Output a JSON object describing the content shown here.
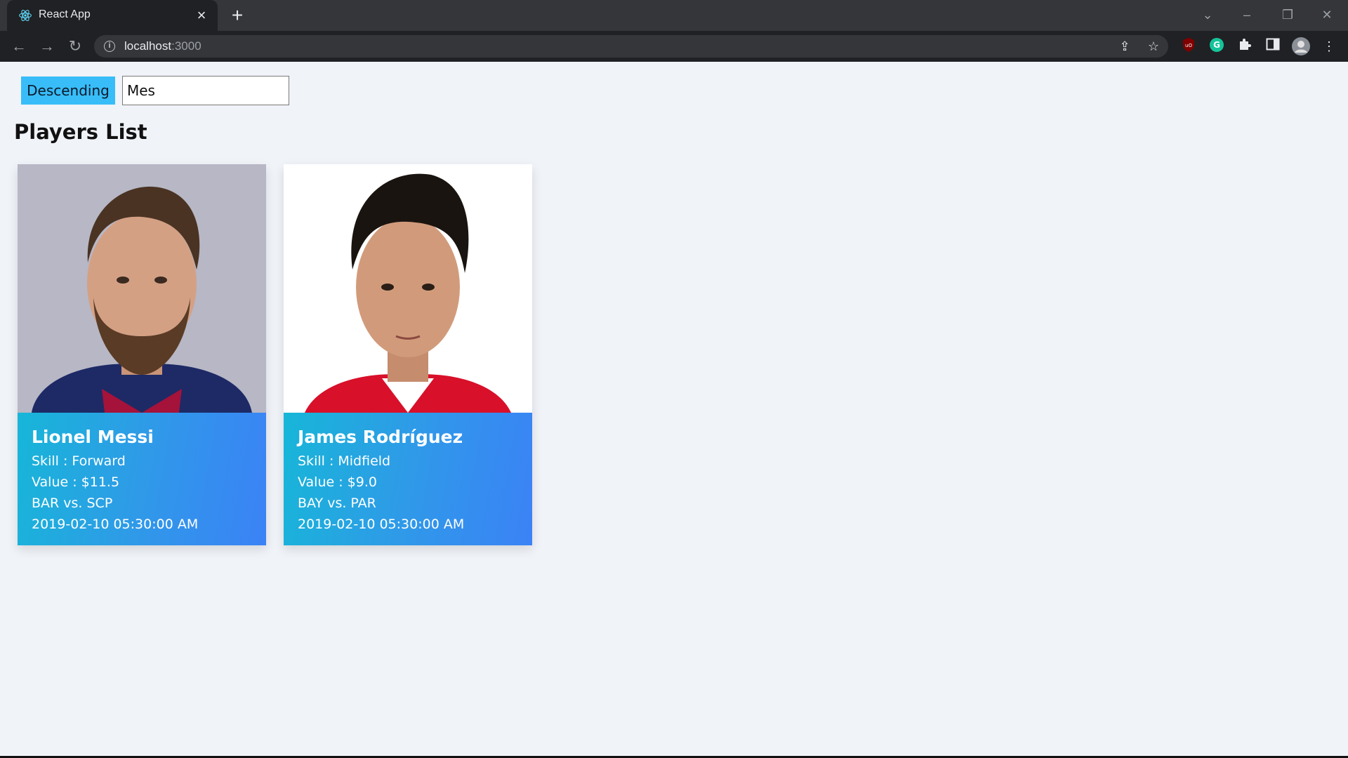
{
  "browser": {
    "tab_title": "React App",
    "url_host": "localhost",
    "url_port": ":3000"
  },
  "controls": {
    "sort_label": "Descending",
    "search_value": "Mes"
  },
  "page": {
    "title": "Players List"
  },
  "players": [
    {
      "name": "Lionel Messi",
      "skill": "Skill : Forward",
      "value": "Value : $11.5",
      "match": "BAR vs. SCP",
      "datetime": "2019-02-10 05:30:00 AM"
    },
    {
      "name": "James Rodríguez",
      "skill": "Skill : Midfield",
      "value": "Value : $9.0",
      "match": "BAY vs. PAR",
      "datetime": "2019-02-10 05:30:00 AM"
    }
  ]
}
